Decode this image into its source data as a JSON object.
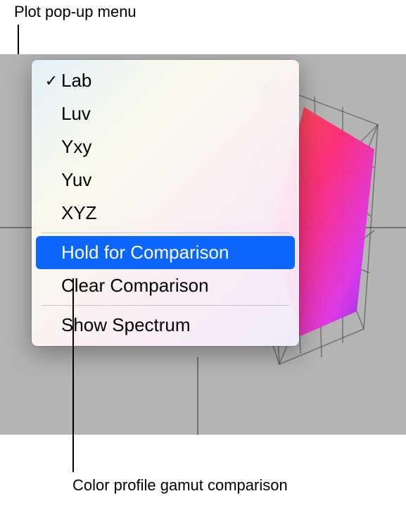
{
  "annotations": {
    "top_label": "Plot pop-up menu",
    "bottom_label": "Color profile gamut comparison"
  },
  "menu": {
    "items": [
      {
        "label": "Lab",
        "checked": true
      },
      {
        "label": "Luv",
        "checked": false
      },
      {
        "label": "Yxy",
        "checked": false
      },
      {
        "label": "Yuv",
        "checked": false
      },
      {
        "label": "XYZ",
        "checked": false
      }
    ],
    "hold_label": "Hold for Comparison",
    "clear_label": "Clear Comparison",
    "spectrum_label": "Show Spectrum",
    "checkmark": "✓"
  }
}
